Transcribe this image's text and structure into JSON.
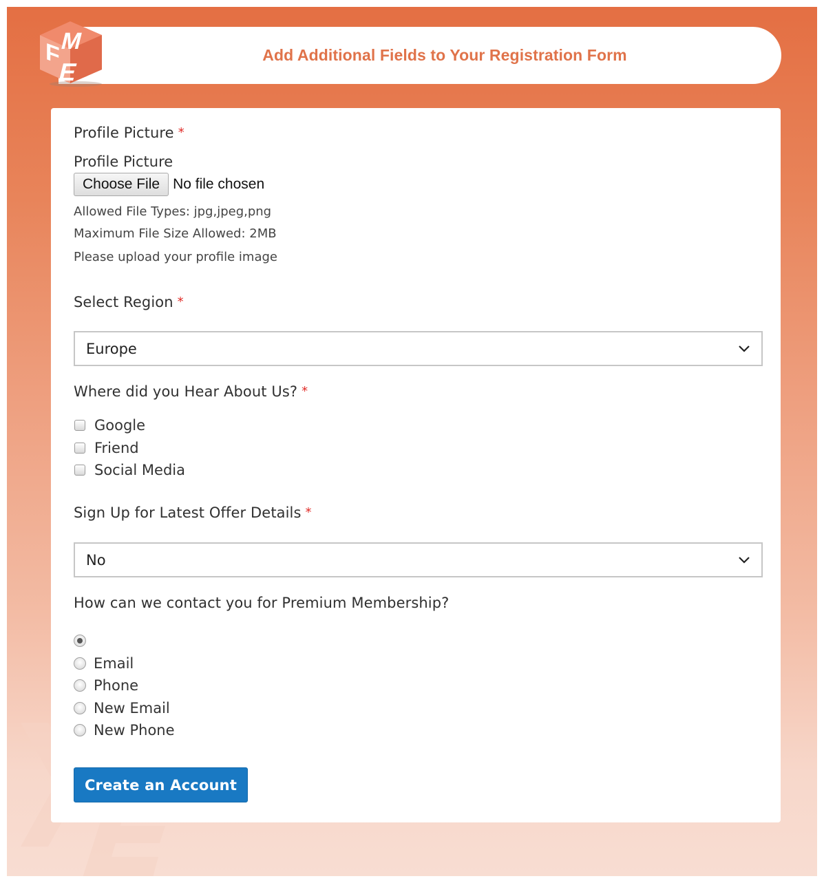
{
  "header": {
    "title": "Add Additional Fields to Your Registration Form",
    "logo_letters": [
      "F",
      "M",
      "E"
    ],
    "brand_color": "#e46f43"
  },
  "form": {
    "profile_picture": {
      "label": "Profile Picture",
      "required_mark": "*",
      "sub_label": "Profile Picture",
      "choose_file_label": "Choose File",
      "file_status": "No file chosen",
      "notes": [
        "Allowed File Types: jpg,jpeg,png",
        "Maximum File Size Allowed: 2MB",
        "Please upload your profile image"
      ]
    },
    "region": {
      "label": "Select Region",
      "required_mark": "*",
      "selected": "Europe",
      "icon": "chevron-down-icon"
    },
    "hear_about": {
      "label": "Where did you Hear About Us?",
      "required_mark": "*",
      "options": [
        {
          "label": "Google",
          "checked": false
        },
        {
          "label": "Friend",
          "checked": false
        },
        {
          "label": "Social Media",
          "checked": false
        }
      ]
    },
    "offers": {
      "label": "Sign Up for Latest Offer Details",
      "required_mark": "*",
      "selected": "No",
      "icon": "chevron-down-icon"
    },
    "contact": {
      "label": "How can we contact you for Premium Membership?",
      "options": [
        {
          "label": "",
          "checked": true
        },
        {
          "label": "Email",
          "checked": false
        },
        {
          "label": "Phone",
          "checked": false
        },
        {
          "label": "New Email",
          "checked": false
        },
        {
          "label": "New Phone",
          "checked": false
        }
      ]
    },
    "submit_label": "Create an Account",
    "submit_color": "#1979c3",
    "required_color": "#e02b27"
  }
}
